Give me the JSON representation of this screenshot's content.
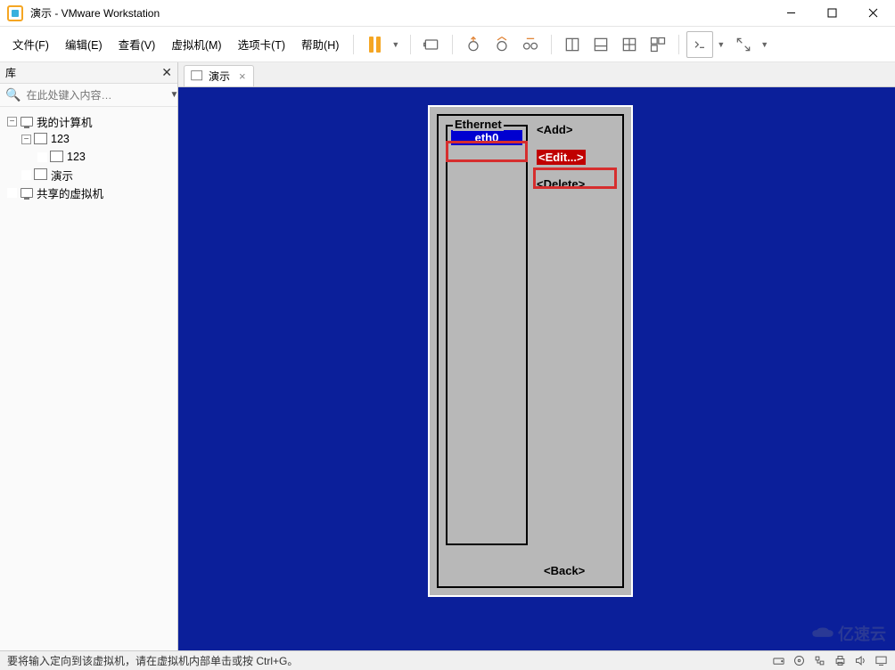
{
  "window": {
    "title": "演示 - VMware Workstation"
  },
  "menus": {
    "file": "文件(F)",
    "edit": "编辑(E)",
    "view": "查看(V)",
    "vm": "虚拟机(M)",
    "tabs": "选项卡(T)",
    "help": "帮助(H)"
  },
  "sidebar": {
    "title": "库",
    "search_placeholder": "在此处键入内容…",
    "nodes": {
      "root": "我的计算机",
      "n1": "123",
      "n2": "123",
      "n3": "演示",
      "shared": "共享的虚拟机"
    }
  },
  "tab": {
    "label": "演示"
  },
  "nmtui": {
    "section": "Ethernet",
    "selected": "eth0",
    "add": "<Add>",
    "edit": "<Edit...>",
    "delete": "<Delete>",
    "back": "<Back>"
  },
  "statusbar": {
    "hint": "要将输入定向到该虚拟机，请在虚拟机内部单击或按 Ctrl+G。"
  },
  "watermark": "亿速云"
}
